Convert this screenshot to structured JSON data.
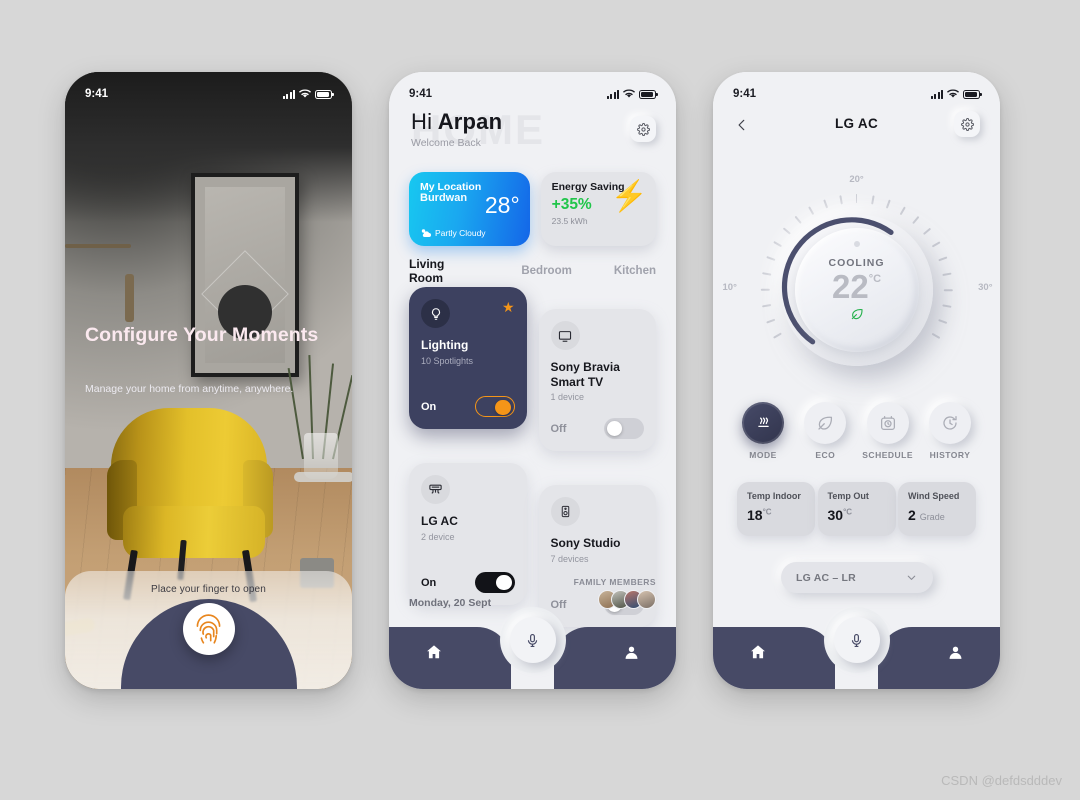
{
  "statusbar": {
    "time": "9:41",
    "icons": [
      "signal-bars",
      "wifi",
      "battery"
    ]
  },
  "screen1": {
    "headline": "Configure Your Moments",
    "subtext": "Manage your home from anytime, anywhere.",
    "hint": "Place your finger to open",
    "fingerprint_icon": "fingerprint-icon",
    "fingerprint_color": "#e8861e"
  },
  "screen2": {
    "watermark": "HOME",
    "greeting_prefix": "Hi",
    "greeting_name": "Arpan",
    "welcome": "Welcome Back",
    "gear_icon": "gear-icon",
    "weather": {
      "label": "My Location",
      "city": "Burdwan",
      "temp": "28°",
      "condition": "Partly Cloudy",
      "condition_icon": "partly-cloudy-icon",
      "gradient_from": "#17c8f0",
      "gradient_to": "#1466e8"
    },
    "energy": {
      "title": "Energy Saving",
      "percent": "+35%",
      "kwh": "23.5 kWh",
      "icon": "lightning-bolt-icon",
      "percent_color": "#20c54a"
    },
    "rooms": [
      {
        "label": "Living Room",
        "active": true
      },
      {
        "label": "Bedroom",
        "active": false
      },
      {
        "label": "Kitchen",
        "active": false
      }
    ],
    "devices": [
      {
        "name": "Lighting",
        "count": "10 Spotlights",
        "state": "On",
        "icon": "lightbulb-icon",
        "starred": true
      },
      {
        "name": "Sony Bravia Smart TV",
        "count": "1 device",
        "state": "Off",
        "icon": "tv-icon",
        "starred": false
      },
      {
        "name": "LG AC",
        "count": "2 device",
        "state": "On",
        "icon": "air-conditioner-icon",
        "starred": false
      },
      {
        "name": "Sony Studio",
        "count": "7 devices",
        "state": "Off",
        "icon": "speaker-icon",
        "starred": false
      }
    ],
    "date": "Monday, 20 Sept",
    "family_label": "FAMILY MEMBERS",
    "family_count": 4,
    "nav": {
      "home_icon": "home-icon",
      "mic_icon": "microphone-icon",
      "profile_icon": "person-icon"
    }
  },
  "screen3": {
    "back_icon": "chevron-left-icon",
    "title": "LG AC",
    "gear_icon": "gear-icon",
    "dial": {
      "mode_text": "COOLING",
      "value": "22",
      "unit": "°C",
      "eco_icon": "leaf-icon",
      "eco_color": "#22b04a",
      "label_top": "20°",
      "label_left": "10°",
      "label_right": "30°",
      "arc_color": "#4b4f6e"
    },
    "modes": [
      {
        "label": "MODE",
        "icon": "heat-waves-icon",
        "active": true
      },
      {
        "label": "ECO",
        "icon": "leaf-icon",
        "active": false
      },
      {
        "label": "SCHEDULE",
        "icon": "timer-icon",
        "active": false
      },
      {
        "label": "HISTORY",
        "icon": "history-clock-icon",
        "active": false
      }
    ],
    "stats": [
      {
        "key": "Temp Indoor",
        "value": "18",
        "unit": "°C"
      },
      {
        "key": "Temp Out",
        "value": "30",
        "unit": "°C"
      },
      {
        "key": "Wind Speed",
        "value": "2",
        "unit": "Grade"
      }
    ],
    "selector": {
      "value": "LG AC – LR",
      "chevron_icon": "chevron-down-icon"
    },
    "nav": {
      "home_icon": "home-icon",
      "mic_icon": "microphone-icon",
      "profile_icon": "person-icon"
    }
  },
  "watermark_credit": "CSDN @defdsdddev"
}
